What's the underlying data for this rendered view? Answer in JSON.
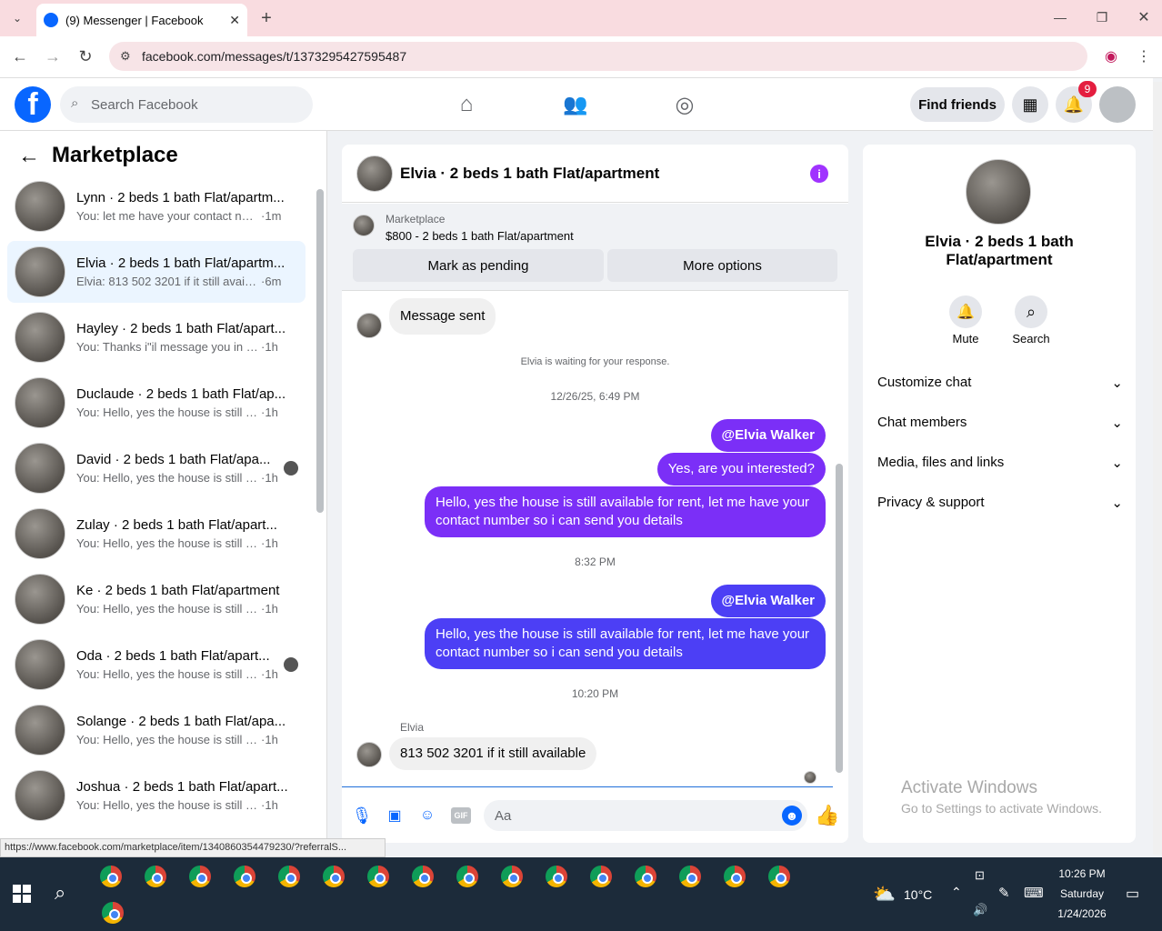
{
  "browser": {
    "tab_title": "(9) Messenger | Facebook",
    "url": "facebook.com/messages/t/1373295427595487",
    "status_url": "https://www.facebook.com/marketplace/item/1340860354479230/?referralS..."
  },
  "fb": {
    "search_placeholder": "Search Facebook",
    "find_friends": "Find friends",
    "notif_count": "9"
  },
  "left": {
    "title": "Marketplace",
    "conversations": [
      {
        "name": "Lynn · 2 beds 1 bath Flat/apartm...",
        "snippet": "You: let me have your contact num...",
        "time": "1m"
      },
      {
        "name": "Elvia · 2 beds 1 bath Flat/apartm...",
        "snippet": "Elvia: 813 502 3201 if it still available",
        "time": "6m"
      },
      {
        "name": "Hayley · 2 beds 1 bath Flat/apart...",
        "snippet": "You: Thanks i\"il message you in a ...",
        "time": "1h"
      },
      {
        "name": "Duclaude · 2 beds 1 bath Flat/ap...",
        "snippet": "You: Hello, yes the house is still avai...",
        "time": "1h"
      },
      {
        "name": "David · 2 beds 1 bath Flat/apa...",
        "snippet": "You: Hello, yes the house is still a...",
        "time": "1h"
      },
      {
        "name": "Zulay · 2 beds 1 bath Flat/apart...",
        "snippet": "You: Hello, yes the house is still avai...",
        "time": "1h"
      },
      {
        "name": "Ke · 2 beds 1 bath Flat/apartment",
        "snippet": "You: Hello, yes the house is still avai...",
        "time": "1h"
      },
      {
        "name": "Oda · 2 beds 1 bath Flat/apart...",
        "snippet": "You: Hello, yes the house is still a...",
        "time": "1h"
      },
      {
        "name": "Solange · 2 beds 1 bath Flat/apa...",
        "snippet": "You: Hello, yes the house is still avai...",
        "time": "1h"
      },
      {
        "name": "Joshua · 2 beds 1 bath Flat/apart...",
        "snippet": "You: Hello, yes the house is still avai...",
        "time": "1h"
      }
    ]
  },
  "chat": {
    "title": "Elvia · 2 beds 1 bath Flat/apartment",
    "market_label": "Marketplace",
    "listing": "$800 - 2 beds 1 bath Flat/apartment",
    "mark_pending": "Mark as pending",
    "more_options": "More options",
    "msg_sent": "Message sent",
    "waiting": "Elvia is waiting for your response.",
    "ts1": "12/26/25, 6:49 PM",
    "mention1": "@Elvia Walker",
    "yes": "Yes, are you interested?",
    "reply1": "Hello, yes the house is still available for rent, let me have your contact number so i can send you details",
    "ts2": "8:32 PM",
    "mention2": "@Elvia Walker",
    "reply2": "Hello, yes the house is still available for rent, let me have your contact number so i can send you details",
    "ts3": "10:20 PM",
    "sender": "Elvia",
    "incoming": "813 502 3201 if it still available",
    "input_placeholder": "Aa"
  },
  "right": {
    "name": "Elvia · 2 beds 1 bath Flat/apartment",
    "mute": "Mute",
    "search": "Search",
    "rows": [
      "Customize chat",
      "Chat members",
      "Media, files and links",
      "Privacy & support"
    ],
    "activate1": "Activate Windows",
    "activate2": "Go to Settings to activate Windows."
  },
  "taskbar": {
    "temp": "10°C",
    "time": "10:26 PM",
    "day": "Saturday",
    "date": "1/24/2026"
  }
}
